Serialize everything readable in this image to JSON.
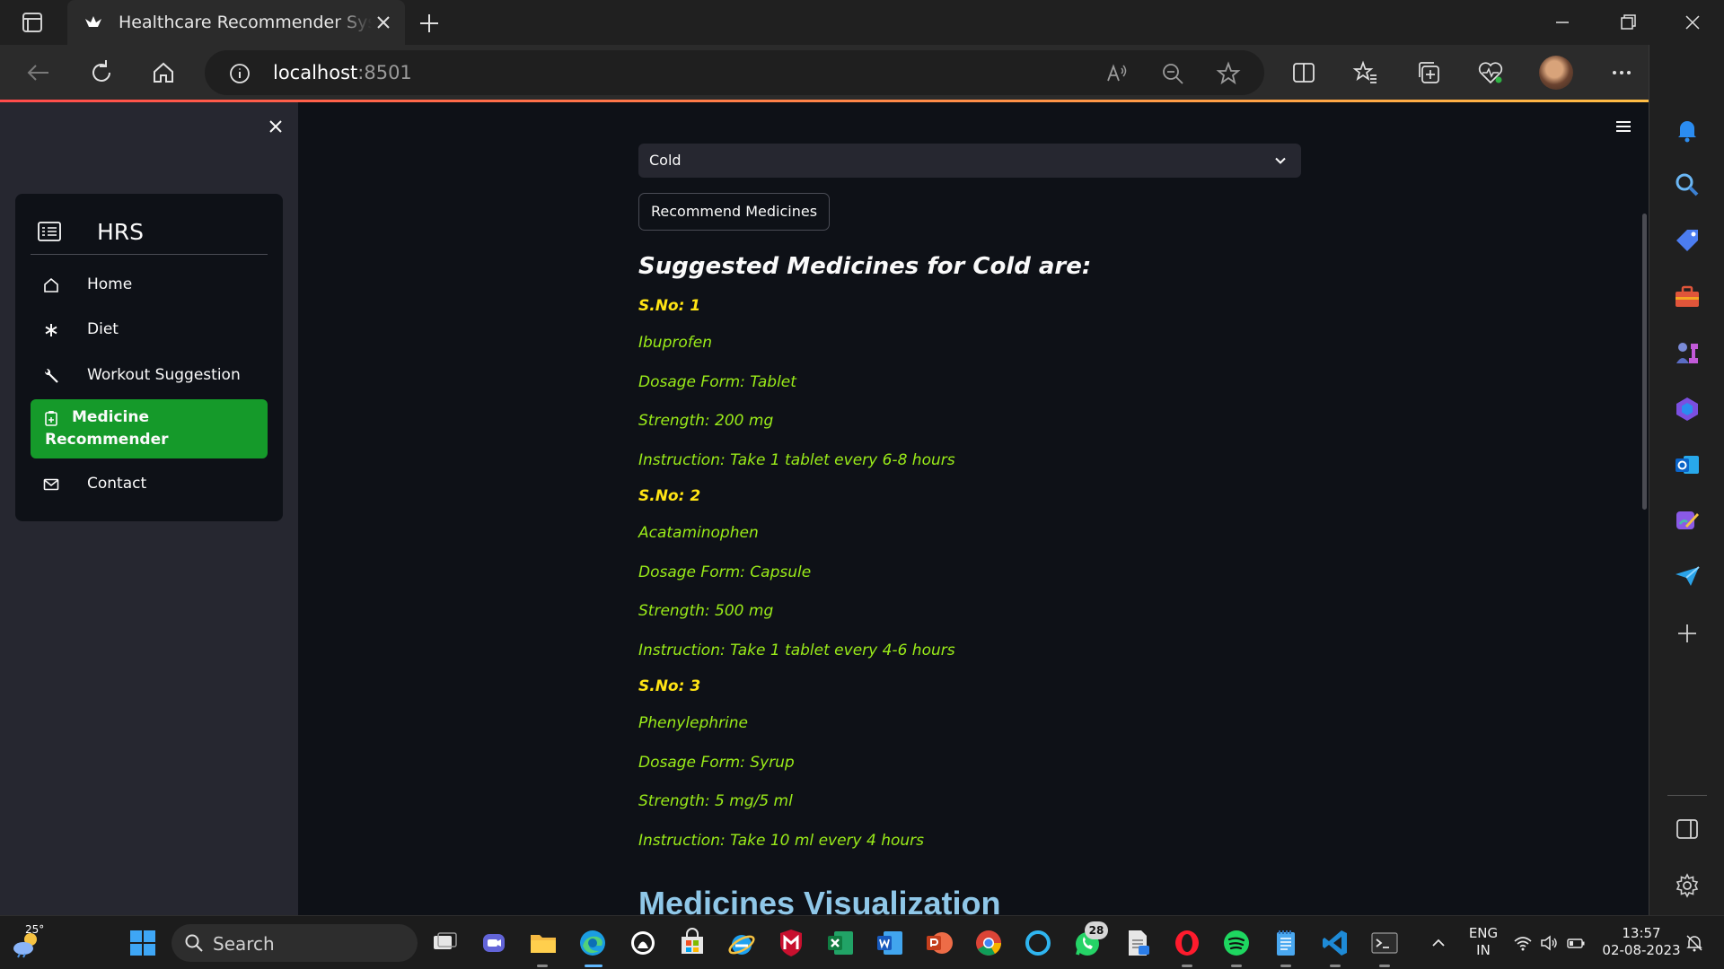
{
  "browser": {
    "tab_title": "Healthcare Recommender System",
    "url_host": "localhost",
    "url_port": ":8501"
  },
  "sidebar": {
    "brand": "HRS",
    "items": [
      {
        "label": "Home",
        "icon": "home-icon"
      },
      {
        "label": "Diet",
        "icon": "asterisk-icon"
      },
      {
        "label": "Workout Suggestion",
        "icon": "wrench-icon"
      },
      {
        "label": "Medicine Recommender",
        "icon": "clipboard-plus-icon",
        "active": true
      },
      {
        "label": "Contact",
        "icon": "envelope-icon"
      }
    ]
  },
  "main": {
    "select_value": "Cold",
    "button_label": "Recommend Medicines",
    "result_title": "Suggested Medicines for Cold are:",
    "medicines": [
      {
        "sno": "S.No: 1",
        "name": "Ibuprofen",
        "form": "Dosage Form: Tablet",
        "strength": "Strength: 200 mg",
        "instruction": "Instruction: Take 1 tablet every 6-8 hours"
      },
      {
        "sno": "S.No: 2",
        "name": "Acataminophen",
        "form": "Dosage Form: Capsule",
        "strength": "Strength: 500 mg",
        "instruction": "Instruction: Take 1 tablet every 4-6 hours"
      },
      {
        "sno": "S.No: 3",
        "name": "Phenylephrine",
        "form": "Dosage Form: Syrup",
        "strength": "Strength: 5 mg/5 ml",
        "instruction": "Instruction: Take 10 ml every 4 hours"
      }
    ],
    "viz_title": "Medicines Visualization"
  },
  "colors": {
    "accent": "#159a2a",
    "medicine_text": "#9aeb19",
    "sno_text": "#ffe414",
    "viz_title": "#8fc7e8",
    "app_bg": "#0e1117",
    "sidebar_bg": "#262730"
  },
  "taskbar": {
    "weather_temp": "25°",
    "search_label": "Search",
    "whatsapp_badge": "28",
    "lang_line1": "ENG",
    "lang_line2": "IN",
    "time": "13:57",
    "date": "02-08-2023"
  }
}
